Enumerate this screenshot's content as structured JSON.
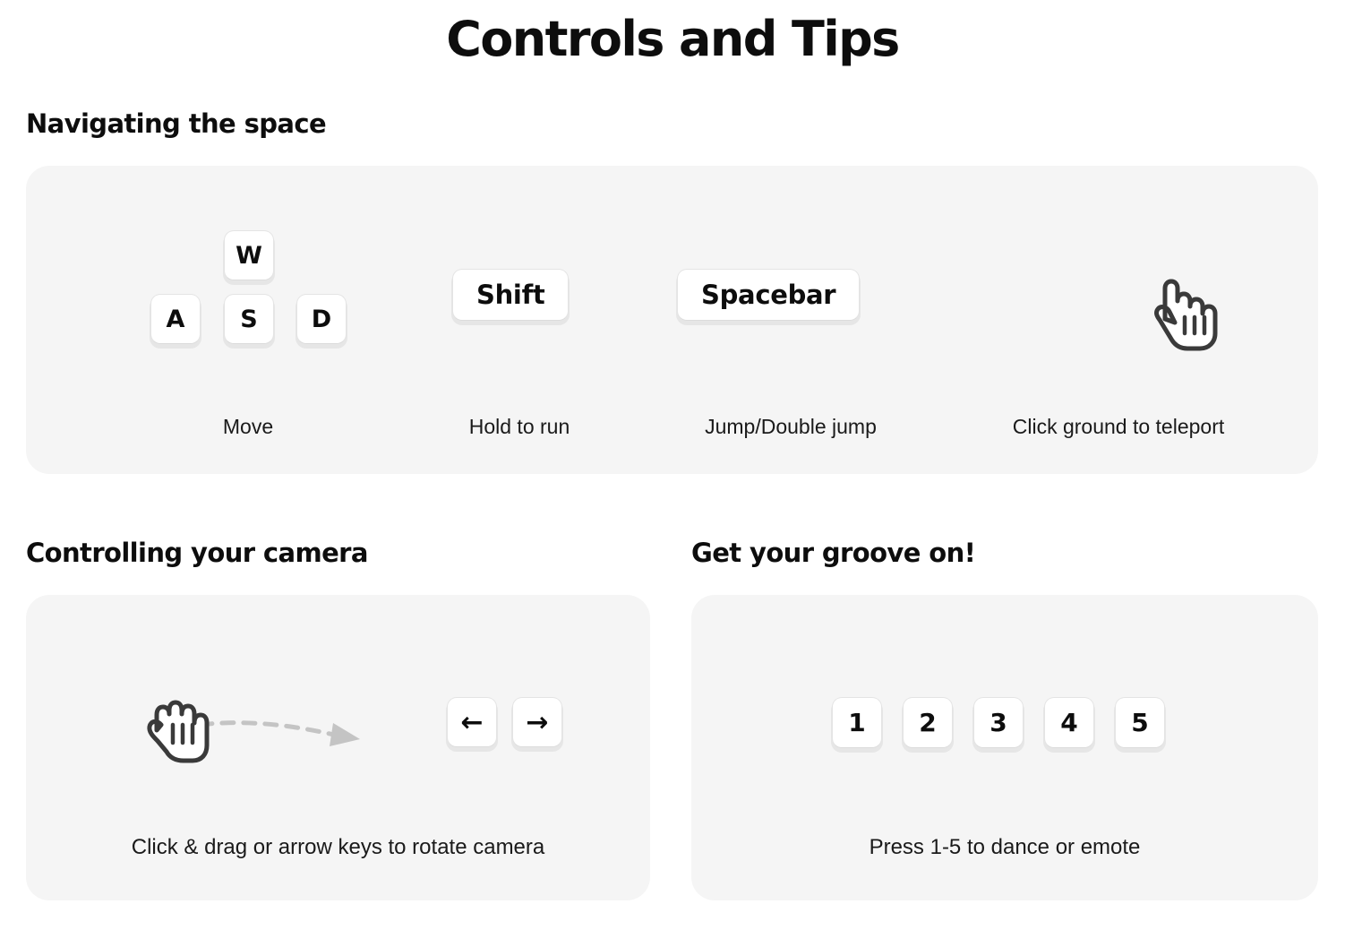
{
  "page": {
    "title": "Controls and Tips",
    "background_color": "#ffffff",
    "panel_color": "#f5f5f5",
    "text_color": "#111111"
  },
  "sections": {
    "navigating": {
      "heading": "Navigating the space",
      "groups": [
        {
          "name": "move",
          "keys": [
            "W",
            "A",
            "S",
            "D"
          ],
          "caption": "Move"
        },
        {
          "name": "run",
          "keys": [
            "Shift"
          ],
          "caption": "Hold to run"
        },
        {
          "name": "jump",
          "keys": [
            "Spacebar"
          ],
          "caption": "Jump/Double jump"
        },
        {
          "name": "teleport",
          "icon": "pointing-hand-cursor-icon",
          "caption": "Click ground to teleport"
        }
      ]
    },
    "camera": {
      "heading": "Controlling your camera",
      "icon": "grabbing-hand-drag-icon",
      "keys": [
        "←",
        "→"
      ],
      "caption": "Click & drag or arrow keys to rotate camera"
    },
    "groove": {
      "heading": "Get your groove on!",
      "keys": [
        "1",
        "2",
        "3",
        "4",
        "5"
      ],
      "caption": "Press 1-5 to dance or emote"
    }
  }
}
